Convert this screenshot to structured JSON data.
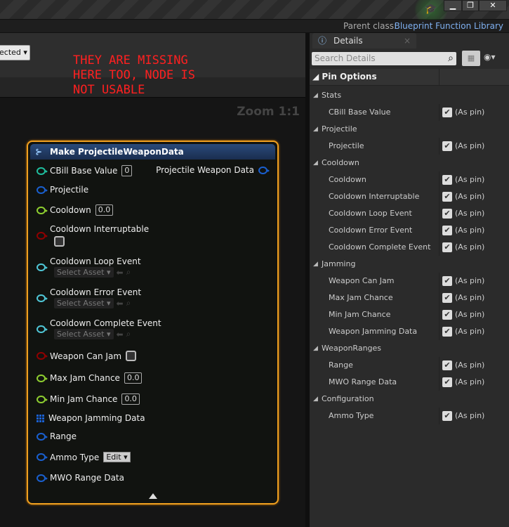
{
  "window": {
    "minimize": "▁",
    "restore": "❐",
    "close": "✕"
  },
  "toolbar": {
    "parent_label": "Parent class:",
    "parent_value": "Blueprint Function Library"
  },
  "graph": {
    "dropdown": "ected ▾",
    "annotation": "THEY ARE MISSING\nHERE TOO, NODE IS\nNOT USABLE",
    "zoom": "Zoom 1:1"
  },
  "node": {
    "title": "Make ProjectileWeaponData",
    "output": "Projectile Weapon Data",
    "pins": [
      {
        "label": "CBill Base Value",
        "value": "0",
        "color": "#1fbf9f",
        "kind": "int"
      },
      {
        "label": "Projectile",
        "color": "#1a60d0",
        "kind": "struct"
      },
      {
        "label": "Cooldown",
        "value": "0.0",
        "color": "#8fd030",
        "kind": "float"
      },
      {
        "label": "Cooldown Interruptable",
        "color": "#900000",
        "kind": "bool"
      },
      {
        "label": "Cooldown Loop Event",
        "asset": "Select Asset ▾",
        "color": "#50c8d8",
        "kind": "asset"
      },
      {
        "label": "Cooldown Error Event",
        "asset": "Select Asset ▾",
        "color": "#50c8d8",
        "kind": "asset"
      },
      {
        "label": "Cooldown Complete Event",
        "asset": "Select Asset ▾",
        "color": "#50c8d8",
        "kind": "asset"
      },
      {
        "label": "Weapon Can Jam",
        "color": "#900000",
        "kind": "bool"
      },
      {
        "label": "Max Jam Chance",
        "value": "0.0",
        "color": "#8fd030",
        "kind": "float"
      },
      {
        "label": "Min Jam Chance",
        "value": "0.0",
        "color": "#8fd030",
        "kind": "float"
      },
      {
        "label": "Weapon Jamming Data",
        "color": "#1a60d0",
        "kind": "array"
      },
      {
        "label": "Range",
        "color": "#1a60d0",
        "kind": "struct"
      },
      {
        "label": "Ammo Type",
        "edit": "Edit ▾",
        "color": "#1a60d0",
        "kind": "enum"
      },
      {
        "label": "MWO Range Data",
        "color": "#1a60d0",
        "kind": "struct"
      }
    ]
  },
  "details": {
    "tab": "Details",
    "search_placeholder": "Search Details",
    "section": "Pin Options",
    "as_pin": "(As pin)",
    "rows": [
      {
        "type": "cat",
        "label": "Stats"
      },
      {
        "type": "item",
        "label": "CBill Base Value"
      },
      {
        "type": "cat",
        "label": "Projectile"
      },
      {
        "type": "item",
        "label": "Projectile"
      },
      {
        "type": "cat",
        "label": "Cooldown"
      },
      {
        "type": "item",
        "label": "Cooldown"
      },
      {
        "type": "item",
        "label": "Cooldown Interruptable"
      },
      {
        "type": "item",
        "label": "Cooldown Loop Event"
      },
      {
        "type": "item",
        "label": "Cooldown Error Event"
      },
      {
        "type": "item",
        "label": "Cooldown Complete Event"
      },
      {
        "type": "cat",
        "label": "Jamming"
      },
      {
        "type": "item",
        "label": "Weapon Can Jam"
      },
      {
        "type": "item",
        "label": "Max Jam Chance"
      },
      {
        "type": "item",
        "label": "Min Jam Chance"
      },
      {
        "type": "item",
        "label": "Weapon Jamming Data"
      },
      {
        "type": "cat",
        "label": "WeaponRanges"
      },
      {
        "type": "item",
        "label": "Range"
      },
      {
        "type": "item",
        "label": "MWO Range Data"
      },
      {
        "type": "cat",
        "label": "Configuration"
      },
      {
        "type": "item",
        "label": "Ammo Type"
      }
    ]
  }
}
